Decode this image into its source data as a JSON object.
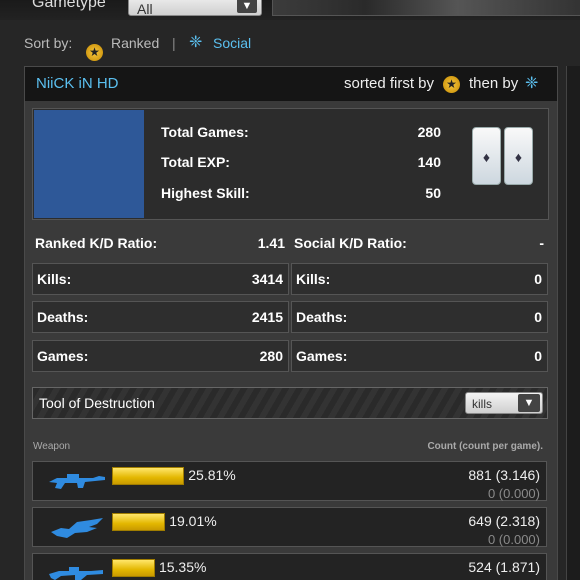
{
  "gametype": {
    "label": "Gametype",
    "value": "All"
  },
  "sort": {
    "label": "Sort by:",
    "ranked": "Ranked",
    "separator": "|",
    "social": "Social"
  },
  "panel": {
    "player_name": "NiiCK iN HD",
    "sorted_first_by": "sorted first by",
    "then_by": "then by"
  },
  "summary": {
    "total_games_label": "Total Games:",
    "total_games": "280",
    "total_exp_label": "Total EXP:",
    "total_exp": "140",
    "highest_skill_label": "Highest Skill:",
    "highest_skill": "50"
  },
  "stats": {
    "ranked_kd_label": "Ranked K/D Ratio:",
    "ranked_kd": "1.41",
    "social_kd_label": "Social K/D Ratio:",
    "social_kd": "-",
    "ranked": [
      {
        "label": "Kills:",
        "value": "3414"
      },
      {
        "label": "Deaths:",
        "value": "2415"
      },
      {
        "label": "Games:",
        "value": "280"
      }
    ],
    "social": [
      {
        "label": "Kills:",
        "value": "0"
      },
      {
        "label": "Deaths:",
        "value": "0"
      },
      {
        "label": "Games:",
        "value": "0"
      }
    ]
  },
  "tool_of_destruction": {
    "title": "Tool of Destruction",
    "sort_value": "kills"
  },
  "weapons": {
    "col_weapon": "Weapon",
    "col_count": "Count (count per game).",
    "rows": [
      {
        "icon": "sniper-rifle-icon",
        "percent_value": 25.81,
        "percent": "25.81%",
        "ranked": "881 (3.146)",
        "social": "0 (0.000)"
      },
      {
        "icon": "energy-sword-icon",
        "percent_value": 19.01,
        "percent": "19.01%",
        "ranked": "649 (2.318)",
        "social": "0 (0.000)"
      },
      {
        "icon": "battle-rifle-icon",
        "percent_value": 15.35,
        "percent": "15.35%",
        "ranked": "524 (1.871)",
        "social": ""
      }
    ]
  },
  "colors": {
    "accent": "#5bc0f0",
    "emblem": "#2e5898",
    "bar": "#f0c800"
  }
}
